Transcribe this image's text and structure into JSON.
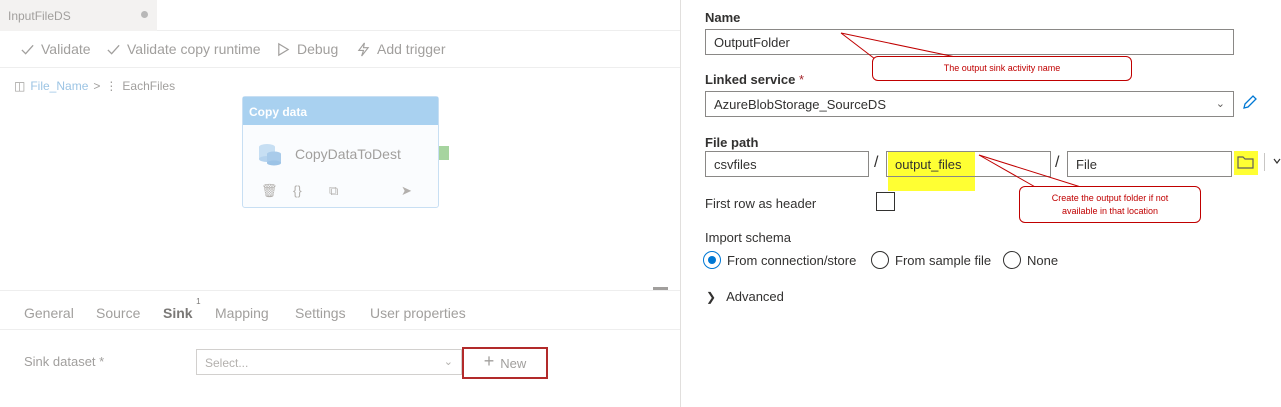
{
  "left": {
    "doc_tab": "InputFileDS",
    "toolbar": {
      "validate": "Validate",
      "validate_copy_runtime": "Validate copy runtime",
      "debug": "Debug",
      "add_trigger": "Add trigger"
    },
    "breadcrumb": {
      "item1": "File_Name",
      "sep": ">",
      "item2": "EachFiles"
    },
    "activity": {
      "header": "Copy data",
      "name": "CopyDataToDest"
    },
    "bottom_tabs": [
      "General",
      "Source",
      "Sink",
      "Mapping",
      "Settings",
      "User properties"
    ],
    "sink_badge": "1",
    "sink_dataset": {
      "label": "Sink dataset",
      "placeholder": "Select...",
      "new_button": "New"
    }
  },
  "right": {
    "name": {
      "label": "Name",
      "value": "OutputFolder"
    },
    "linked_service": {
      "label": "Linked service",
      "value": "AzureBlobStorage_SourceDS"
    },
    "file_path": {
      "label": "File path",
      "container": "csvfiles",
      "directory": "output_files",
      "file": "File",
      "sep": "/"
    },
    "first_row_header": {
      "label": "First row as header"
    },
    "import_schema": {
      "label": "Import schema",
      "options": [
        "From connection/store",
        "From sample file",
        "None"
      ],
      "selected": "From connection/store"
    },
    "advanced": "Advanced",
    "required_mark": "*"
  },
  "annotations": {
    "name_note": "The output sink activity name",
    "folder_note_line1": "Create the output folder if not",
    "folder_note_line2": "available in that location"
  },
  "colors": {
    "accent": "#0078d4",
    "annotation": "#c00000",
    "highlight": "#ffff33"
  }
}
